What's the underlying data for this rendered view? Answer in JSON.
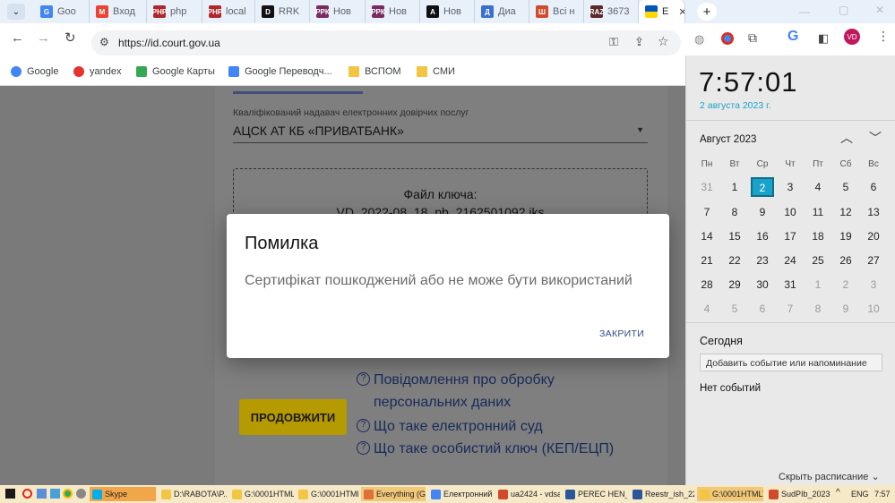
{
  "browser": {
    "tabs": [
      {
        "label": "Goo",
        "icon": "google-icon",
        "color": "#4285f4"
      },
      {
        "label": "Вход",
        "icon": "gmail-icon",
        "color": "#ea4335"
      },
      {
        "label": "php",
        "icon": "php-icon",
        "color": "#b0262d"
      },
      {
        "label": "local",
        "icon": "php-icon",
        "color": "#b0262d"
      },
      {
        "label": "RRK",
        "icon": "d-logo-icon",
        "color": "#111111"
      },
      {
        "label": "Нов",
        "icon": "rrk-icon",
        "color": "#7b2b63"
      },
      {
        "label": "Нов",
        "icon": "rrk-icon",
        "color": "#7b2b63"
      },
      {
        "label": "Нов",
        "icon": "a-logo-icon",
        "color": "#111111"
      },
      {
        "label": "Диа",
        "icon": "d-icon",
        "color": "#3b6fd1"
      },
      {
        "label": "Всі н",
        "icon": "news-icon",
        "color": "#d14a2b"
      },
      {
        "label": "3673",
        "icon": "raz-icon",
        "color": "#5a2a2a"
      },
      {
        "label": "E",
        "icon": "ukraine-flag-icon",
        "color": "#1565c0"
      }
    ],
    "tab_letters": [
      "G",
      "M",
      "PHP",
      "PHP",
      "D",
      "РРК",
      "РРК",
      "A",
      "Д",
      "Ш",
      "RAZ",
      ""
    ],
    "url": "https://id.court.gov.ua",
    "bookmarks": [
      {
        "label": "Google",
        "icon": "google-icon",
        "color": "#4285f4"
      },
      {
        "label": "yandex",
        "icon": "yandex-icon",
        "color": "#e3342f"
      },
      {
        "label": "Google Карты",
        "icon": "maps-pin-icon",
        "color": "#34a853"
      },
      {
        "label": "Google Переводч...",
        "icon": "translate-icon",
        "color": "#4285f4"
      },
      {
        "label": "ВСПОМ",
        "icon": "folder-icon",
        "color": "#f4c542"
      },
      {
        "label": "СМИ",
        "icon": "folder-icon",
        "color": "#f4c542"
      }
    ],
    "profile_initials": "VD",
    "new_tab": "+"
  },
  "page": {
    "provider_label": "Кваліфікований надавач електронних довірчих послуг",
    "provider_value": "АЦСК АТ КБ «ПРИВАТБАНК»",
    "key_file_label": "Файл ключа:",
    "key_file_name": "VD_2022-08_18_pb_2162501092.jks",
    "continue_button": "ПРОДОВЖИТИ",
    "links": [
      "Повідомлення про обробку",
      "персональних даних",
      "Що таке електронний суд",
      "Що таке особистий ключ (КЕП/ЕЦП)"
    ]
  },
  "dialog": {
    "title": "Помилка",
    "message": "Сертифікат пошкоджений або не може бути використаний",
    "close_button": "ЗАКРИТИ"
  },
  "calendar": {
    "time": "7:57:01",
    "date": "2 августа 2023 г.",
    "month": "Август 2023",
    "weekdays": [
      "Пн",
      "Вт",
      "Ср",
      "Чт",
      "Пт",
      "Сб",
      "Вс"
    ],
    "weeks": [
      [
        "31",
        "1",
        "2",
        "3",
        "4",
        "5",
        "6"
      ],
      [
        "7",
        "8",
        "9",
        "10",
        "11",
        "12",
        "13"
      ],
      [
        "14",
        "15",
        "16",
        "17",
        "18",
        "19",
        "20"
      ],
      [
        "21",
        "22",
        "23",
        "24",
        "25",
        "26",
        "27"
      ],
      [
        "28",
        "29",
        "30",
        "31",
        "1",
        "2",
        "3"
      ],
      [
        "4",
        "5",
        "6",
        "7",
        "8",
        "9",
        "10"
      ]
    ],
    "today_label": "Сегодня",
    "add_event_button": "Добавить событие или напоминание",
    "no_events": "Нет событий",
    "hide_schedule": "Скрыть расписание",
    "accent_color": "#1aa3c9"
  },
  "taskbar": {
    "items": [
      {
        "label": "Skype",
        "color": "#00aff0",
        "active": true
      },
      {
        "label": "D:\\RABOTA\\P...",
        "color": "#f4c542",
        "active": false
      },
      {
        "label": "G:\\0001HTML\\...",
        "color": "#f4c542",
        "active": false
      },
      {
        "label": "G:\\0001HTML\\...",
        "color": "#f4c542",
        "active": false
      },
      {
        "label": "Everything (G-...",
        "color": "#e0703a",
        "active": true
      },
      {
        "label": "Електронний ...",
        "color": "#4285f4",
        "active": false
      },
      {
        "label": "ua2424 - vdsa...",
        "color": "#d14a2b",
        "active": false
      },
      {
        "label": "PEREC HEN_D...",
        "color": "#2b579a",
        "active": false
      },
      {
        "label": "Reestr_ish_22_...",
        "color": "#2b579a",
        "active": false
      },
      {
        "label": "G:\\0001HTML\\...",
        "color": "#f4c542",
        "active": true
      },
      {
        "label": "SudPIb_2023-...",
        "color": "#d14a2b",
        "active": false
      }
    ],
    "language": "ENG",
    "clock": "7:57"
  }
}
